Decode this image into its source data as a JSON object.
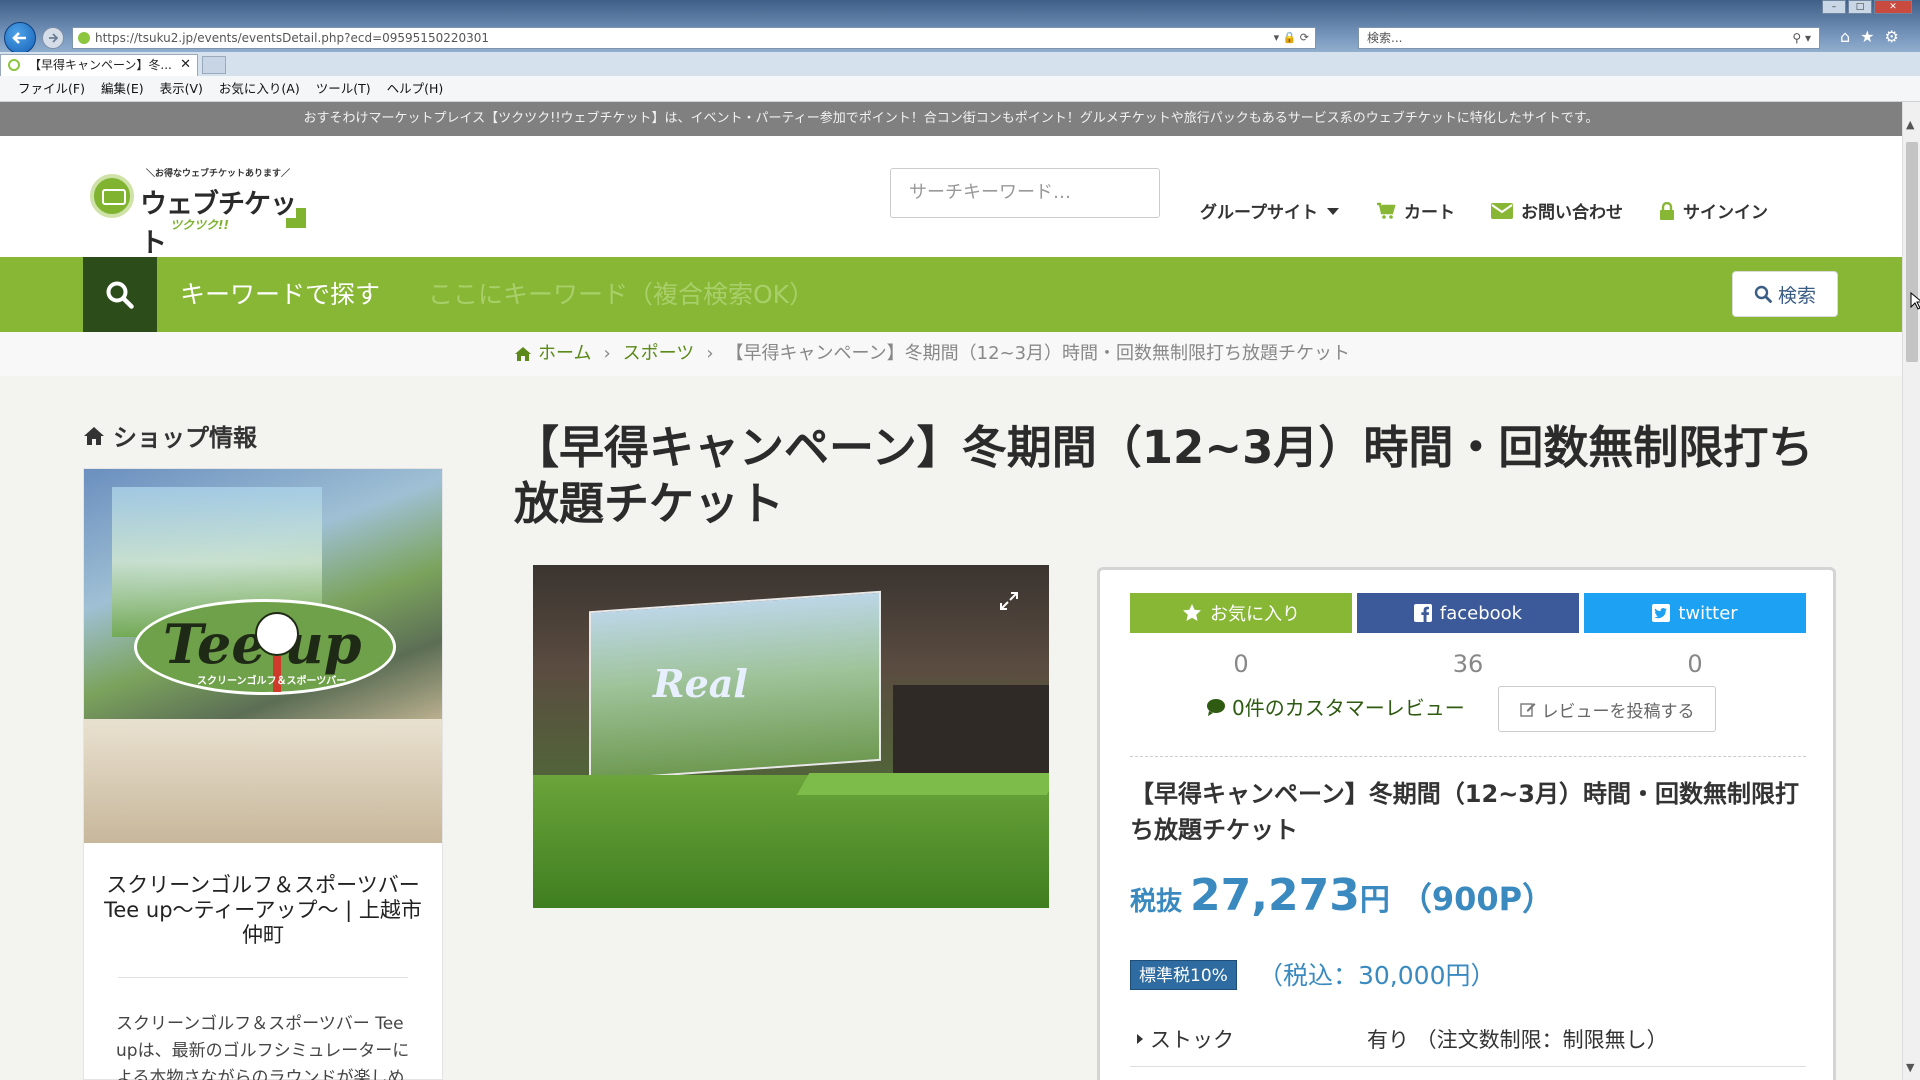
{
  "browser": {
    "url": "https://tsuku2.jp/events/eventsDetail.php?ecd=09595150220301",
    "search_placeholder": "検索...",
    "tab_title": "【早得キャンペーン】冬...",
    "menu": [
      "ファイル(F)",
      "編集(E)",
      "表示(V)",
      "お気に入り(A)",
      "ツール(T)",
      "ヘルプ(H)"
    ]
  },
  "promo_text": "おすそわけマーケットプレイス【ツクツク!!ウェブチケット】は、イベント・パーティー参加でポイント！合コン街コンもポイント！グルメチケットや旅行パックもあるサービス系のウェブチケットに特化したサイトです。",
  "header": {
    "logo_tagline": "＼お得なウェブチケットあります／",
    "logo_name": "ウェブチケット",
    "logo_sub": "ツクツク!!",
    "search_placeholder": "サーチキーワード…",
    "nav": {
      "group": "グループサイト",
      "cart": "カート",
      "contact": "お問い合わせ",
      "signin": "サインイン"
    }
  },
  "keyword_bar": {
    "label": "キーワードで探す",
    "placeholder": "ここにキーワード（複合検索OK）",
    "button": "検索"
  },
  "breadcrumb": {
    "home": "ホーム",
    "category": "スポーツ",
    "current": "【早得キャンペーン】冬期間（12~3月）時間・回数無制限打ち放題チケット"
  },
  "sidebar": {
    "title": "ショップ情報",
    "image_logo_text": "Tee up",
    "image_logo_sub": "スクリーンゴルフ＆スポーツバー",
    "shop_name": "スクリーンゴルフ＆スポーツバー Tee up～ティーアップ～ | 上越市仲町",
    "shop_desc": "スクリーンゴルフ＆スポーツバー Tee upは、最新のゴルフシミュレーターによる本物さながらのラウンドが楽しめ"
  },
  "product": {
    "title": "【早得キャンペーン】冬期間（12~3月）時間・回数無制限打ち放題チケット",
    "image_text": "Real",
    "share": {
      "favorite_label": "お気に入り",
      "favorite_count": "0",
      "facebook_label": "facebook",
      "facebook_count": "36",
      "twitter_label": "twitter",
      "twitter_count": "0"
    },
    "review_count_text": "0件のカスタマーレビュー",
    "review_button": "レビューを投稿する",
    "name": "【早得キャンペーン】冬期間（12~3月）時間・回数無制限打ち放題チケット",
    "price_prefix": "税抜",
    "price_amount": "27,273",
    "price_unit": "円",
    "price_points": "（900P）",
    "tax_badge": "標準税10%",
    "tax_included": "（税込：30,000円）",
    "stock_label": "ストック",
    "stock_value": "有り （注文数制限：制限無し）"
  },
  "colors": {
    "green": "#87b734",
    "dark_green": "#2c4c1a",
    "price_blue": "#3a8ac0",
    "facebook": "#3c5a99",
    "twitter": "#1da1f2"
  }
}
